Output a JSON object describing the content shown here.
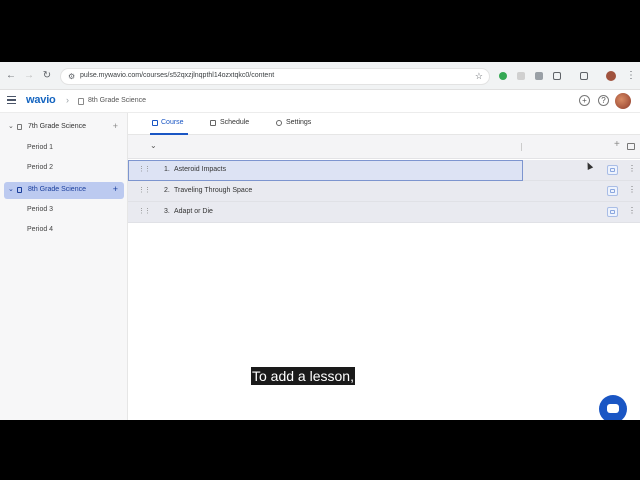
{
  "browser": {
    "url": "pulse.mywavio.com/courses/s52qxzjlnqpthl14ozxtqkc0/content"
  },
  "app": {
    "logo": "wavio",
    "breadcrumb": "8th Grade Science"
  },
  "sidebar": {
    "courses": [
      {
        "label": "7th Grade Science",
        "periods": [
          "Period 1",
          "Period 2"
        ]
      },
      {
        "label": "8th Grade Science",
        "periods": [
          "Period 3",
          "Period 4"
        ]
      }
    ]
  },
  "tabs": [
    "Course",
    "Schedule",
    "Settings"
  ],
  "lessons": [
    {
      "num": "1.",
      "title": "Asteroid Impacts"
    },
    {
      "num": "2.",
      "title": "Traveling Through Space"
    },
    {
      "num": "3.",
      "title": "Adapt or Die"
    }
  ],
  "caption": "To add a lesson,",
  "colors": {
    "accent": "#1a56c4",
    "active_course_bg": "#bccaf0"
  }
}
